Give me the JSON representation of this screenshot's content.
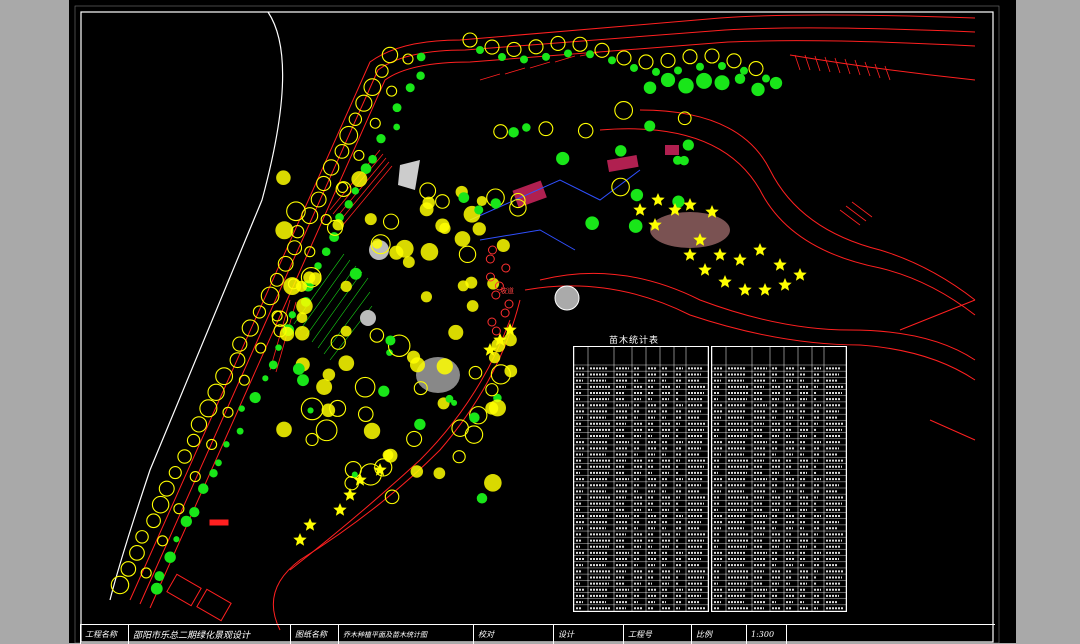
{
  "title_block": {
    "project_label": "工程名称",
    "project_name": "邵阳市乐总二期绿化景观设计",
    "drawing_label": "图纸名称",
    "drawing_name": "乔木种植平面及苗木统计图",
    "designer_label": "设计",
    "checker_label": "校对",
    "drawing_no_label": "工程号",
    "scale_label": "比例",
    "scale_value": "1:300"
  },
  "tables": {
    "title": "苗木统计表",
    "left_rows": 40,
    "right_rows": 40
  },
  "annotations": {
    "slope_label": "坡道"
  },
  "colors": {
    "background": "#000000",
    "frame": "#ffffff",
    "boundary": "#ff2020",
    "tree_yellow": "#ffff00",
    "shrub_green": "#19e619",
    "label_white": "#ffffff"
  }
}
